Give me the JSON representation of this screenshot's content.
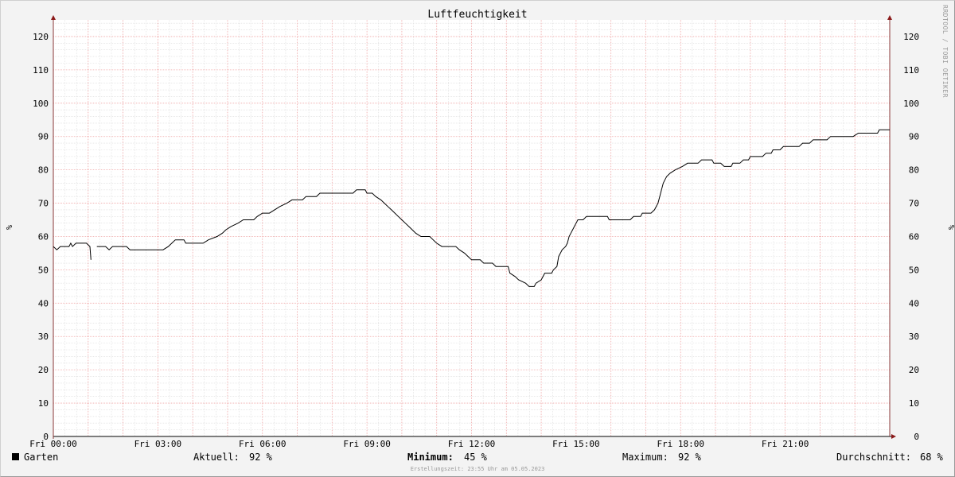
{
  "chart_data": {
    "type": "line",
    "title": "Luftfeuchtigkeit",
    "ylabel": "%",
    "ylim": [
      0,
      125
    ],
    "y_ticks": [
      "0",
      "10",
      "20",
      "30",
      "40",
      "50",
      "60",
      "70",
      "80",
      "90",
      "100",
      "110",
      "120"
    ],
    "x_range_hours": [
      0,
      24
    ],
    "x_ticks": [
      {
        "hour": 0,
        "label": "Fri 00:00"
      },
      {
        "hour": 3,
        "label": "Fri 03:00"
      },
      {
        "hour": 6,
        "label": "Fri 06:00"
      },
      {
        "hour": 9,
        "label": "Fri 09:00"
      },
      {
        "hour": 12,
        "label": "Fri 12:00"
      },
      {
        "hour": 15,
        "label": "Fri 15:00"
      },
      {
        "hour": 18,
        "label": "Fri 18:00"
      },
      {
        "hour": 21,
        "label": "Fri 21:00"
      }
    ],
    "grid": true,
    "series": [
      {
        "name": "Garten",
        "color": "#000000",
        "segments": [
          [
            [
              0.0,
              57
            ],
            [
              0.1,
              56
            ],
            [
              0.2,
              57
            ],
            [
              0.45,
              57
            ],
            [
              0.5,
              58
            ],
            [
              0.55,
              57
            ],
            [
              0.65,
              58
            ],
            [
              0.95,
              58
            ],
            [
              1.05,
              57
            ],
            [
              1.08,
              53
            ]
          ],
          [
            [
              1.25,
              57
            ],
            [
              1.5,
              57
            ],
            [
              1.6,
              56
            ],
            [
              1.7,
              57
            ],
            [
              2.1,
              57
            ],
            [
              2.2,
              56
            ],
            [
              3.15,
              56
            ],
            [
              3.3,
              57
            ],
            [
              3.4,
              58
            ],
            [
              3.5,
              59
            ],
            [
              3.75,
              59
            ],
            [
              3.8,
              58
            ],
            [
              4.3,
              58
            ],
            [
              4.45,
              59
            ],
            [
              4.7,
              60
            ],
            [
              4.85,
              61
            ],
            [
              4.95,
              62
            ],
            [
              5.1,
              63
            ],
            [
              5.3,
              64
            ],
            [
              5.45,
              65
            ],
            [
              5.75,
              65
            ],
            [
              5.85,
              66
            ],
            [
              6.0,
              67
            ],
            [
              6.2,
              67
            ],
            [
              6.35,
              68
            ],
            [
              6.5,
              69
            ],
            [
              6.7,
              70
            ],
            [
              6.85,
              71
            ],
            [
              7.15,
              71
            ],
            [
              7.25,
              72
            ],
            [
              7.55,
              72
            ],
            [
              7.65,
              73
            ],
            [
              8.6,
              73
            ],
            [
              8.7,
              74
            ],
            [
              8.95,
              74
            ],
            [
              9.0,
              73
            ],
            [
              9.15,
              73
            ],
            [
              9.25,
              72
            ],
            [
              9.4,
              71
            ],
            [
              9.5,
              70
            ],
            [
              9.6,
              69
            ],
            [
              9.7,
              68
            ],
            [
              9.8,
              67
            ],
            [
              9.9,
              66
            ],
            [
              10.0,
              65
            ],
            [
              10.1,
              64
            ],
            [
              10.2,
              63
            ],
            [
              10.3,
              62
            ],
            [
              10.4,
              61
            ],
            [
              10.55,
              60
            ],
            [
              10.8,
              60
            ],
            [
              10.9,
              59
            ],
            [
              11.0,
              58
            ],
            [
              11.15,
              57
            ],
            [
              11.55,
              57
            ],
            [
              11.65,
              56
            ],
            [
              11.8,
              55
            ],
            [
              11.9,
              54
            ],
            [
              12.0,
              53
            ],
            [
              12.25,
              53
            ],
            [
              12.35,
              52
            ],
            [
              12.6,
              52
            ],
            [
              12.7,
              51
            ],
            [
              13.05,
              51
            ],
            [
              13.1,
              49
            ],
            [
              13.25,
              48
            ],
            [
              13.35,
              47
            ],
            [
              13.55,
              46
            ],
            [
              13.65,
              45
            ],
            [
              13.8,
              45
            ],
            [
              13.85,
              46
            ],
            [
              14.0,
              47
            ],
            [
              14.1,
              49
            ],
            [
              14.3,
              49
            ],
            [
              14.35,
              50
            ],
            [
              14.45,
              51
            ],
            [
              14.5,
              54
            ],
            [
              14.6,
              56
            ],
            [
              14.7,
              57
            ],
            [
              14.75,
              58
            ],
            [
              14.8,
              60
            ],
            [
              14.85,
              61
            ],
            [
              14.9,
              62
            ],
            [
              14.95,
              63
            ],
            [
              15.0,
              64
            ],
            [
              15.05,
              65
            ],
            [
              15.2,
              65
            ],
            [
              15.3,
              66
            ],
            [
              15.9,
              66
            ],
            [
              15.95,
              65
            ],
            [
              16.55,
              65
            ],
            [
              16.65,
              66
            ],
            [
              16.85,
              66
            ],
            [
              16.9,
              67
            ],
            [
              17.15,
              67
            ],
            [
              17.25,
              68
            ],
            [
              17.35,
              70
            ],
            [
              17.4,
              72
            ],
            [
              17.45,
              74
            ],
            [
              17.5,
              76
            ],
            [
              17.55,
              77
            ],
            [
              17.6,
              78
            ],
            [
              17.7,
              79
            ],
            [
              17.85,
              80
            ],
            [
              18.05,
              81
            ],
            [
              18.2,
              82
            ],
            [
              18.5,
              82
            ],
            [
              18.6,
              83
            ],
            [
              18.9,
              83
            ],
            [
              18.95,
              82
            ],
            [
              19.15,
              82
            ],
            [
              19.25,
              81
            ],
            [
              19.45,
              81
            ],
            [
              19.5,
              82
            ],
            [
              19.7,
              82
            ],
            [
              19.8,
              83
            ],
            [
              19.95,
              83
            ],
            [
              20.0,
              84
            ],
            [
              20.35,
              84
            ],
            [
              20.45,
              85
            ],
            [
              20.6,
              85
            ],
            [
              20.65,
              86
            ],
            [
              20.85,
              86
            ],
            [
              20.95,
              87
            ],
            [
              21.4,
              87
            ],
            [
              21.5,
              88
            ],
            [
              21.7,
              88
            ],
            [
              21.8,
              89
            ],
            [
              22.2,
              89
            ],
            [
              22.3,
              90
            ],
            [
              22.95,
              90
            ],
            [
              23.1,
              91
            ],
            [
              23.65,
              91
            ],
            [
              23.7,
              92
            ],
            [
              24.0,
              92
            ]
          ]
        ]
      }
    ]
  },
  "watermark": "RRDTOOL / TOBI OETIKER",
  "legend": {
    "series_name": "Garten",
    "current_label": "Aktuell:",
    "current_value": "92 %",
    "min_label": "Minimum:",
    "min_value": "45 %",
    "max_label": "Maximum:",
    "max_value": "92 %",
    "avg_label": "Durchschnitt:",
    "avg_value": "68 %"
  },
  "footer": "Erstellungszeit: 23:55 Uhr am 05.05.2023"
}
